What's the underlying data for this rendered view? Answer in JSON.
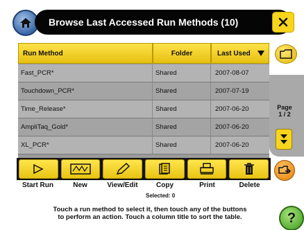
{
  "header": {
    "title": "Browse Last Accessed Run Methods (10)"
  },
  "table": {
    "columns": [
      "Run Method",
      "Folder",
      "Last Used"
    ],
    "rows": [
      {
        "name": "Fast_PCR*",
        "folder": "Shared",
        "last_used": "2007-08-07"
      },
      {
        "name": "Touchdown_PCR*",
        "folder": "Shared",
        "last_used": "2007-07-19"
      },
      {
        "name": "Time_Release*",
        "folder": "Shared",
        "last_used": "2007-06-20"
      },
      {
        "name": "AmpliTaq_Gold*",
        "folder": "Shared",
        "last_used": "2007-06-20"
      },
      {
        "name": "XL_PCR*",
        "folder": "Shared",
        "last_used": "2007-06-20"
      }
    ]
  },
  "pager": {
    "label": "Page",
    "value": "1 / 2"
  },
  "toolbar": {
    "buttons": [
      "Start Run",
      "New",
      "View/Edit",
      "Copy",
      "Print",
      "Delete"
    ],
    "selected": "Selected: 0"
  },
  "help": {
    "line1": "Touch a run method to select it, then touch any of the buttons",
    "line2": "to perform an action. Touch a column title to sort the table.",
    "button": "?"
  },
  "colors": {
    "accent": "#f7d51d",
    "titlebar": "#050505",
    "rows": "#b3b3b3"
  },
  "icons": [
    "home-icon",
    "close-icon",
    "folder-icon",
    "chevron-down-icon",
    "start-run-icon",
    "new-icon",
    "pencil-icon",
    "copy-icon",
    "print-icon",
    "trash-icon",
    "export-icon"
  ]
}
